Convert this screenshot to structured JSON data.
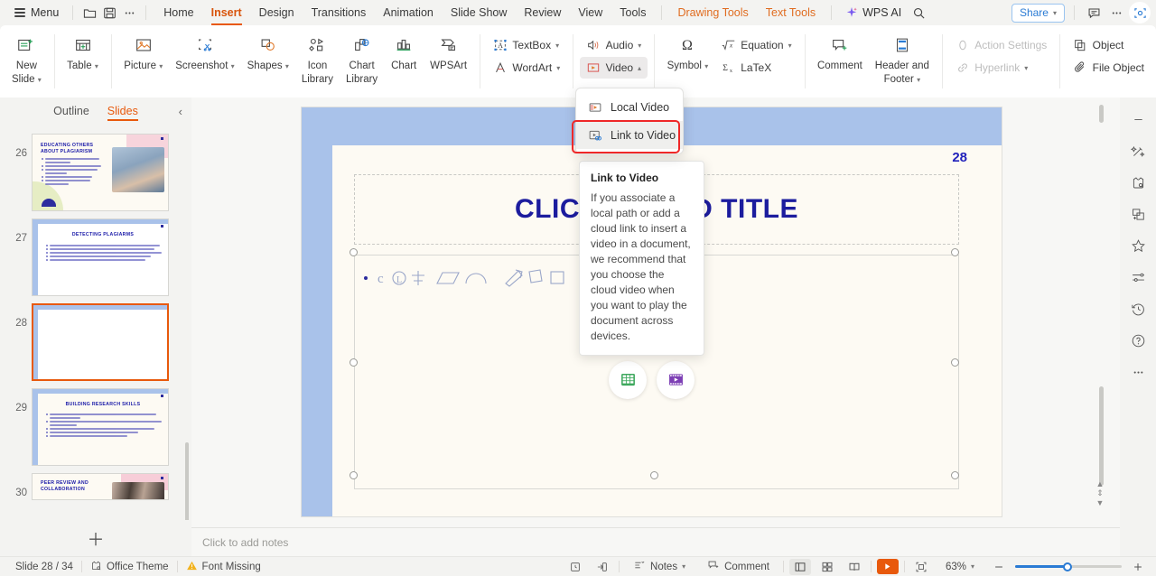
{
  "menubar": {
    "menu_label": "Menu",
    "quick_icons": [
      "open-folder-icon",
      "save-icon",
      "more-options-icon"
    ],
    "tabs": [
      {
        "label": "Home",
        "state": "normal"
      },
      {
        "label": "Insert",
        "state": "active"
      },
      {
        "label": "Design",
        "state": "normal"
      },
      {
        "label": "Transitions",
        "state": "normal"
      },
      {
        "label": "Animation",
        "state": "normal"
      },
      {
        "label": "Slide Show",
        "state": "normal"
      },
      {
        "label": "Review",
        "state": "normal"
      },
      {
        "label": "View",
        "state": "normal"
      },
      {
        "label": "Tools",
        "state": "normal"
      },
      {
        "label": "Drawing Tools",
        "state": "contextual"
      },
      {
        "label": "Text Tools",
        "state": "contextual"
      }
    ],
    "ai_label": "WPS AI",
    "search_icon": "search-icon",
    "share_label": "Share",
    "comment_icon": "comment-icon",
    "more_icon": "more-icon",
    "screenshot_icon": "screen-capture-icon"
  },
  "ribbon": {
    "groups": [
      {
        "name": "slides",
        "buttons": [
          {
            "label": "New",
            "label2": "Slide",
            "icon": "new-slide-icon",
            "caret": true
          }
        ]
      },
      {
        "name": "tables",
        "buttons": [
          {
            "label": "Table",
            "icon": "table-icon",
            "caret": true
          }
        ]
      },
      {
        "name": "images",
        "buttons": [
          {
            "label": "Picture",
            "icon": "picture-icon",
            "caret": true
          },
          {
            "label": "Screenshot",
            "icon": "screenshot-icon",
            "caret": true
          },
          {
            "label": "Shapes",
            "icon": "shapes-icon",
            "caret": true
          },
          {
            "label": "Icon",
            "label2": "Library",
            "icon": "icon-library-icon",
            "caret": false
          },
          {
            "label": "Chart",
            "label2": "Library",
            "icon": "chart-library-icon",
            "caret": false
          },
          {
            "label": "Chart",
            "icon": "chart-icon",
            "caret": false
          },
          {
            "label": "WPSArt",
            "icon": "wpsart-icon",
            "caret": false
          }
        ]
      },
      {
        "name": "text",
        "small_buttons": [
          {
            "label": "TextBox",
            "icon": "textbox-icon",
            "caret": true,
            "disabled": false
          },
          {
            "label": "WordArt",
            "icon": "wordart-icon",
            "caret": true,
            "disabled": false
          }
        ]
      },
      {
        "name": "media",
        "small_buttons": [
          {
            "label": "Audio",
            "icon": "audio-icon",
            "caret": true,
            "disabled": false
          },
          {
            "label": "Video",
            "icon": "video-icon",
            "caret": true,
            "disabled": false,
            "pressed": true
          }
        ]
      },
      {
        "name": "symbols",
        "buttons": [
          {
            "label": "Symbol",
            "icon": "omega-icon",
            "caret": true
          }
        ],
        "small_buttons": [
          {
            "label": "Equation",
            "icon": "equation-icon",
            "caret": true,
            "disabled": false
          },
          {
            "label": "LaTeX",
            "icon": "latex-icon",
            "caret": false,
            "disabled": false
          }
        ]
      },
      {
        "name": "comments",
        "buttons": [
          {
            "label": "Comment",
            "icon": "comment-add-icon",
            "caret": false
          },
          {
            "label": "Header and",
            "label2": "Footer",
            "icon": "header-footer-icon",
            "caret": true
          }
        ]
      },
      {
        "name": "links",
        "small_buttons": [
          {
            "label": "Action Settings",
            "icon": "action-settings-icon",
            "caret": false,
            "disabled": true
          },
          {
            "label": "Hyperlink",
            "icon": "hyperlink-icon",
            "caret": true,
            "disabled": true
          }
        ]
      },
      {
        "name": "objects",
        "small_buttons": [
          {
            "label": "Object",
            "icon": "object-icon",
            "caret": false,
            "disabled": false
          },
          {
            "label": "File Object",
            "icon": "file-object-icon",
            "caret": false,
            "disabled": false
          }
        ]
      }
    ]
  },
  "video_dropdown": {
    "items": [
      {
        "label": "Local Video",
        "icon": "local-video-icon",
        "highlighted": false
      },
      {
        "label": "Link to Video",
        "icon": "link-video-icon",
        "highlighted": true
      }
    ]
  },
  "tooltip": {
    "title": "Link to Video",
    "body": "If you associate a local path or add a cloud link to insert a video in a document, we recommend that you choose the cloud video when you want to play the document across devices."
  },
  "left_panel": {
    "tabs": [
      {
        "label": "Outline",
        "active": false
      },
      {
        "label": "Slides",
        "active": true
      }
    ],
    "collapse_icon": "chevron-left-icon",
    "add_slide_icon": "plus-icon",
    "slides": [
      {
        "number": "26",
        "title": "EDUCATING OTHERS ABOUT PLAGIARISM",
        "selected": false,
        "has_image": true,
        "lines": 6
      },
      {
        "number": "27",
        "title": "DETECTING PLAGIARMS",
        "selected": false,
        "has_image": false,
        "lines": 5
      },
      {
        "number": "28",
        "title": "",
        "selected": true,
        "has_image": false,
        "lines": 0
      },
      {
        "number": "29",
        "title": "BUILDING RESEARCH SKILLS",
        "selected": false,
        "has_image": false,
        "lines": 6
      },
      {
        "number": "30",
        "title": "PEER REVIEW AND COLLABORATION",
        "selected": false,
        "has_image": true,
        "lines": 2
      }
    ]
  },
  "slide_canvas": {
    "slide_number": "28",
    "title_placeholder": "CLICK TO ADD TITLE",
    "content_icons": [
      {
        "name": "insert-picture-placeholder",
        "color": "#3e8ee0"
      },
      {
        "name": "insert-chart-placeholder",
        "color": "#f5a623"
      },
      {
        "name": "insert-table-placeholder",
        "color": "#3fa85e"
      },
      {
        "name": "insert-video-placeholder",
        "color": "#7d3fb5"
      }
    ],
    "side_tools": [
      {
        "name": "collapse-toolbar-button",
        "icon": "minus-circle-icon"
      },
      {
        "name": "layers-button",
        "icon": "layers-icon"
      },
      {
        "name": "format-brush-button",
        "icon": "brush-icon"
      },
      {
        "name": "fill-color-button",
        "icon": "paint-bucket-icon"
      },
      {
        "name": "frame-style-button",
        "icon": "frame-icon"
      },
      {
        "name": "shape-text-button",
        "icon": "shape-text-icon"
      }
    ]
  },
  "notes": {
    "placeholder": "Click to add notes"
  },
  "right_rail": {
    "items": [
      {
        "name": "collapse-rail-button",
        "icon": "minus-icon"
      },
      {
        "name": "ai-tools-button",
        "icon": "magic-wand-icon"
      },
      {
        "name": "templates-button",
        "icon": "puzzle-icon"
      },
      {
        "name": "duplicate-button",
        "icon": "copy-icon"
      },
      {
        "name": "favorites-button",
        "icon": "star-icon"
      },
      {
        "name": "settings-button",
        "icon": "sliders-icon"
      },
      {
        "name": "history-button",
        "icon": "history-icon"
      },
      {
        "name": "help-button",
        "icon": "help-circle-icon"
      },
      {
        "name": "more-tools-button",
        "icon": "more-dots-icon"
      }
    ]
  },
  "statusbar": {
    "slide_counter": "Slide 28 / 34",
    "theme_label": "Office Theme",
    "theme_icon": "theme-icon",
    "warning_label": "Font Missing",
    "warning_icon": "warning-icon",
    "notes_label": "Notes",
    "comment_label": "Comment",
    "history_icon": "restore-icon",
    "export_icon": "export-icon",
    "view_normal_icon": "normal-view-icon",
    "view_sorter_icon": "slide-sorter-icon",
    "view_reading_icon": "reading-view-icon",
    "play_icon": "play-icon",
    "fit_icon": "fit-to-window-icon",
    "zoom_level": "63%",
    "zoom_out_icon": "minus-icon",
    "zoom_in_icon": "plus-icon"
  }
}
